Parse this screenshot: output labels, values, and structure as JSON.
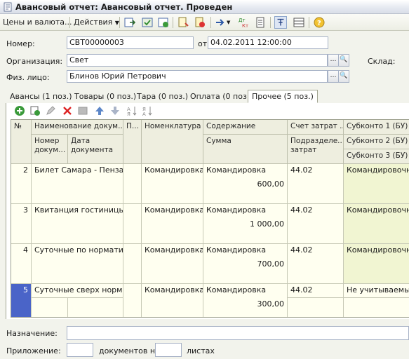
{
  "window": {
    "title": "Авансовый отчет: Авансовый отчет. Проведен"
  },
  "toolbar": {
    "prices_label": "Цены и валюта...",
    "actions_label": "Действия"
  },
  "header": {
    "number_label": "Номер:",
    "number_value": "СВТ00000003",
    "from_label": "от:",
    "date_value": "04.02.2011 12:00:00",
    "org_label": "Организация:",
    "org_value": "Свет",
    "warehouse_label": "Склад:",
    "person_label": "Физ. лицо:",
    "person_value": "Блинов Юрий Петрович"
  },
  "tabs": [
    {
      "label": "Авансы (1 поз.)"
    },
    {
      "label": "Товары (0 поз.)"
    },
    {
      "label": "Тара (0 поз.)"
    },
    {
      "label": "Оплата (0 поз.)"
    },
    {
      "label": "Прочее (5 поз.)"
    }
  ],
  "grid": {
    "columns": {
      "num": "№",
      "name": "Наименование докум...",
      "doc_number": "Номер докум...",
      "doc_date": "Дата документа",
      "p": "П...",
      "nomenclature": "Номенклатура",
      "content": "Содержание",
      "sum": "Сумма",
      "account": "Счет затрат ...",
      "division": "Подразделе... затрат",
      "subconto1": "Субконто 1 (БУ)",
      "subconto2": "Субконто 2 (БУ)",
      "subconto3": "Субконто 3 (БУ)"
    },
    "rows": [
      {
        "num": "2",
        "name": "Билет Самара - Пенза",
        "nomenclature": "Командировка",
        "content": "Командировка",
        "sum": "600,00",
        "account": "44.02",
        "subconto1": "Командировочные"
      },
      {
        "num": "3",
        "name": "Квитанция гостиницы",
        "nomenclature": "Командировка",
        "content": "Командировка",
        "sum": "1 000,00",
        "account": "44.02",
        "subconto1": "Командировочные"
      },
      {
        "num": "4",
        "name": "Суточные по нормативу",
        "nomenclature": "Командировка",
        "content": "Командировка",
        "sum": "700,00",
        "account": "44.02",
        "subconto1": "Командировочные"
      },
      {
        "num": "5",
        "name": "Суточные сверх норм...",
        "nomenclature": "Командировка",
        "content": "Командировка",
        "sum": "300,00",
        "account": "44.02",
        "subconto1": "Не учитываемые"
      }
    ]
  },
  "footer": {
    "purpose_label": "Назначение:",
    "purpose_value": "",
    "attachment_label": "Приложение:",
    "docs_label": "документов на",
    "sheets_label": "листах",
    "docs_count": "",
    "sheets_count": ""
  },
  "colors": {
    "selected_row_num": "#4a64c8",
    "grid_bg": "#fffff0",
    "header_bg": "#eeeedf"
  }
}
